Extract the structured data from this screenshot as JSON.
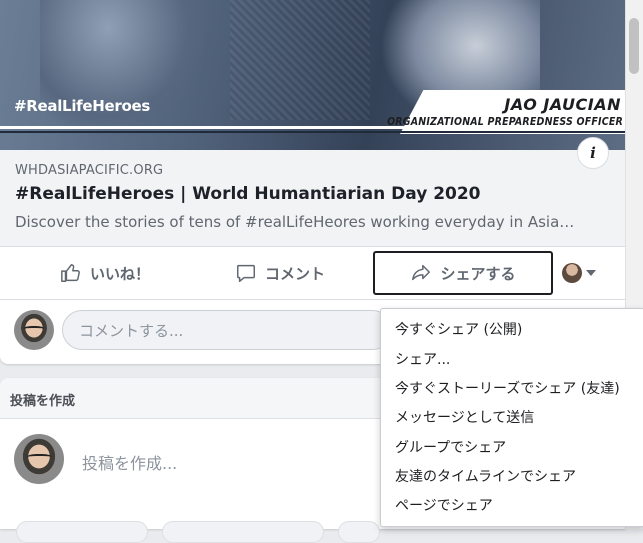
{
  "link_preview": {
    "hashtag_overlay": "#RealLifeHeroes",
    "person_name": "JAO JAUCIAN",
    "person_title": "ORGANIZATIONAL PREPAREDNESS OFFICER",
    "domain": "WHDASIAPACIFIC.ORG",
    "title": "#RealLifeHeroes | World Humantiarian Day 2020",
    "description": "Discover the stories of tens of #realLifeHeores working everyday in Asia…",
    "info_icon": "i"
  },
  "actions": {
    "like_label": "いいね！",
    "comment_label": "コメント",
    "share_label": "シェアする",
    "like_icon": "thumbs-up-icon",
    "comment_icon": "speech-bubble-icon",
    "share_icon": "share-arrow-icon"
  },
  "comment_box": {
    "placeholder": "コメントする..."
  },
  "composer": {
    "header": "投稿を作成",
    "placeholder": "投稿を作成..."
  },
  "share_menu": {
    "items": [
      "今すぐシェア (公開)",
      "シェア...",
      "今すぐストーリーズでシェア (友達)",
      "メッセージとして送信",
      "グループでシェア",
      "友達のタイムラインでシェア",
      "ページでシェア"
    ]
  },
  "colors": {
    "page_bg": "#e9ebee",
    "text_secondary": "#606770",
    "link_meta_bg": "#f2f3f5"
  }
}
